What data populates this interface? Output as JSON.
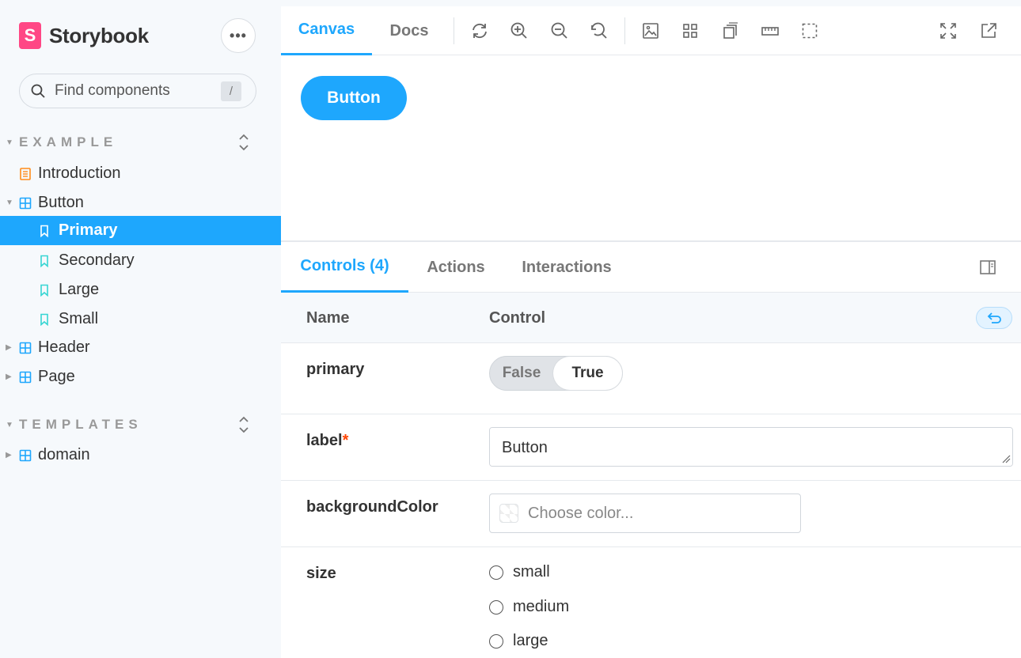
{
  "sidebar": {
    "brand": "Storybook",
    "brand_logo": "S",
    "menu_label": "•••",
    "search": {
      "placeholder": "Find components",
      "shortcut": "/"
    },
    "groups": [
      {
        "title": "EXAMPLE"
      },
      {
        "title": "TEMPLATES"
      }
    ],
    "items": [
      {
        "label": "Introduction",
        "icon": "document-icon"
      },
      {
        "label": "Button",
        "icon": "component-icon"
      },
      {
        "label": "Primary",
        "icon": "bookmark-icon",
        "selected": true
      },
      {
        "label": "Secondary",
        "icon": "bookmark-icon"
      },
      {
        "label": "Large",
        "icon": "bookmark-icon"
      },
      {
        "label": "Small",
        "icon": "bookmark-icon"
      },
      {
        "label": "Header",
        "icon": "component-icon"
      },
      {
        "label": "Page",
        "icon": "component-icon"
      },
      {
        "label": "domain",
        "icon": "component-icon"
      }
    ]
  },
  "toolbar": {
    "tabs": [
      "Canvas",
      "Docs"
    ],
    "active_tab": "Canvas",
    "tools": [
      "refresh-icon",
      "zoom-in-icon",
      "zoom-out-icon",
      "zoom-reset-icon",
      "background-icon",
      "grid-icon",
      "viewport-icon",
      "measure-icon",
      "outline-icon",
      "fullscreen-icon",
      "open-new-tab-icon"
    ]
  },
  "canvas": {
    "button_label": "Button"
  },
  "panel": {
    "tabs": [
      "Controls (4)",
      "Actions",
      "Interactions"
    ],
    "header": {
      "name": "Name",
      "control": "Control"
    },
    "rows": {
      "primary": {
        "name": "primary",
        "false_label": "False",
        "true_label": "True",
        "value": true
      },
      "label": {
        "name": "label",
        "required_mark": "*",
        "value": "Button"
      },
      "background": {
        "name": "backgroundColor",
        "placeholder": "Choose color..."
      },
      "size": {
        "name": "size",
        "options": [
          "small",
          "medium",
          "large"
        ]
      }
    }
  },
  "colors": {
    "accent": "#1ea7fd",
    "brand": "#ff4785",
    "sidebar_bg": "#f6f9fc",
    "doc_icon": "#ff8c1a",
    "component_icon": "#1ea7fd",
    "story_icon": "#37d5d3"
  }
}
